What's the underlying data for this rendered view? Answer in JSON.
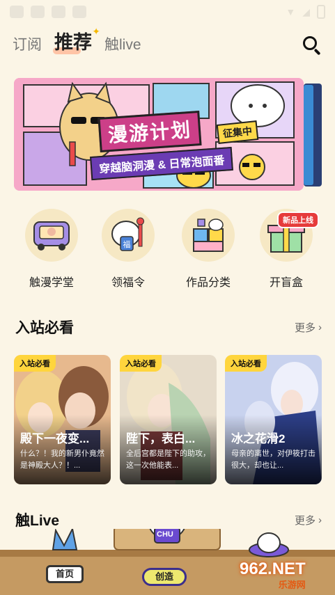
{
  "tabs": [
    {
      "label": "订阅"
    },
    {
      "label": "推荐",
      "active": true
    },
    {
      "label": "触live"
    }
  ],
  "banner": {
    "title": "漫游计划",
    "badge": "征集中",
    "subtitle": "穿越脑洞漫 & 日常泡面番"
  },
  "quick_entries": [
    {
      "label": "触漫学堂",
      "icon": "school-bus-icon"
    },
    {
      "label": "领福令",
      "icon": "lucky-token-icon"
    },
    {
      "label": "作品分类",
      "icon": "category-puzzle-icon"
    },
    {
      "label": "开盲盒",
      "icon": "gift-box-icon",
      "badge": "新品上线"
    }
  ],
  "section_newcomer": {
    "title": "入站必看",
    "more": "更多"
  },
  "cards": [
    {
      "tag": "入站必看",
      "title": "殿下一夜变...",
      "desc": "什么？！我的新男仆竟然是神殿大人？！..."
    },
    {
      "tag": "入站必看",
      "title": "陛下，表白...",
      "desc": "全后宫都是陛下的助攻，这一次他能表..."
    },
    {
      "tag": "入站必看",
      "title": "冰之花滑2",
      "desc": "母亲的离世，对伊筱打击很大，却也让..."
    }
  ],
  "section_live": {
    "title": "触Live",
    "more": "更多"
  },
  "bottom_nav": {
    "home": "首页",
    "create": "创造",
    "center_badge": "CHU"
  },
  "watermark": {
    "brand": "962.NET",
    "sub": "乐游网"
  },
  "colors": {
    "background": "#fbf5e6",
    "tag_yellow": "#ffd53d",
    "accent_pink": "#cc3f88"
  }
}
